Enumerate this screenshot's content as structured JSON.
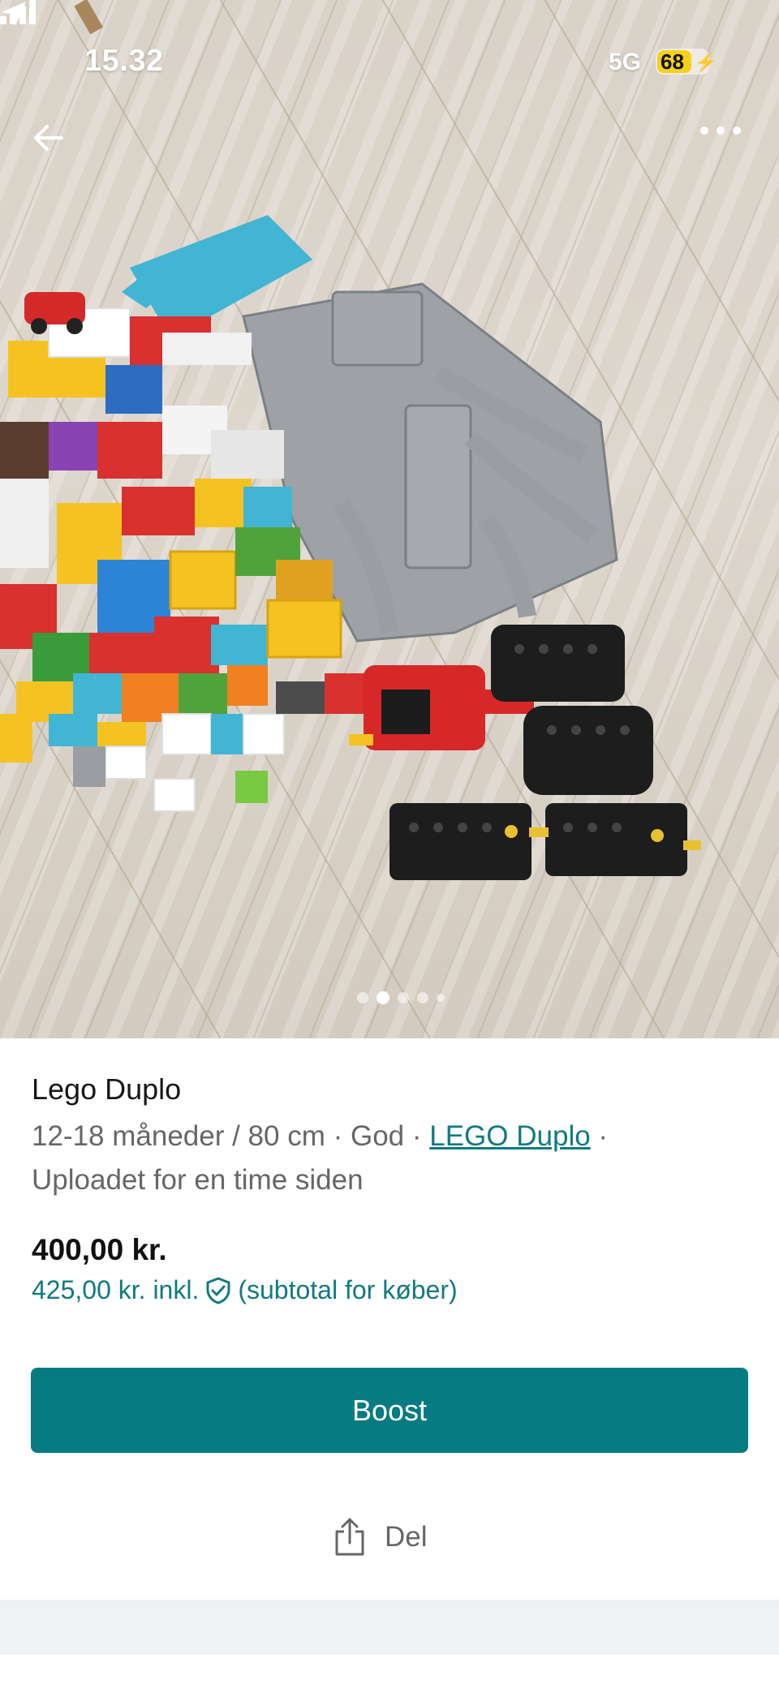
{
  "status_bar": {
    "time": "15.32",
    "network": "5G",
    "battery": "68"
  },
  "colors": {
    "accent": "#067b82",
    "link": "#117a80",
    "battery": "#f4d21a"
  },
  "icons": {
    "back": "back-arrow-icon",
    "more": "more-icon",
    "location": "location-arrow-icon",
    "shield": "shield-check-icon",
    "share": "share-icon"
  },
  "gallery": {
    "image_count": 5,
    "active_index": 1
  },
  "item": {
    "title": "Lego Duplo",
    "size": "12-18 måneder / 80 cm",
    "sep1": " · ",
    "condition": "God",
    "sep2": " · ",
    "brand": "LEGO Duplo",
    "sep3": " · ",
    "uploaded": "Uploadet for en time siden"
  },
  "pricing": {
    "price": "400,00 kr.",
    "incl_prefix": "425,00 kr. inkl.",
    "incl_suffix": "(subtotal for køber)"
  },
  "actions": {
    "boost_label": "Boost",
    "share_label": "Del"
  }
}
